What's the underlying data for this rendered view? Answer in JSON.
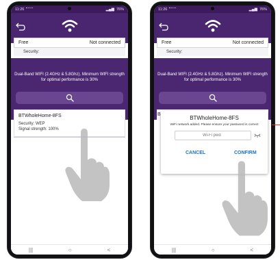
{
  "status_bar": {
    "time": "11:26",
    "battery": "76%"
  },
  "network": {
    "name": "Free",
    "status": "Not connected",
    "security_label": "Security:"
  },
  "info_text": "Dual-Band WIFI (2.4GHz & 5.8Ghz). Minimum WIFI strength for optimal performance is 30%",
  "list_item": {
    "name": "BTWholeHome-8FS",
    "security": "Security:   WEP",
    "signal": "Signal strength:   100%"
  },
  "dialog": {
    "title": "BTWholeHome-8FS",
    "message": "WiFi network added. Please ensure your password is correct",
    "password_placeholder": "Wi-Fi pwd",
    "cancel_label": "CANCEL",
    "confirm_label": "CONFIRM",
    "list_stub": "B"
  },
  "nav": {
    "recents": "|||",
    "home": "○",
    "back": "<"
  },
  "colors": {
    "purple": "#4b2772",
    "header": "#4a2670",
    "search": "#6a4690",
    "button_text": "#1a73c8"
  },
  "icons": [
    "back-icon",
    "wifi-icon",
    "search-icon",
    "eye-icon",
    "hand-pointer-icon"
  ]
}
